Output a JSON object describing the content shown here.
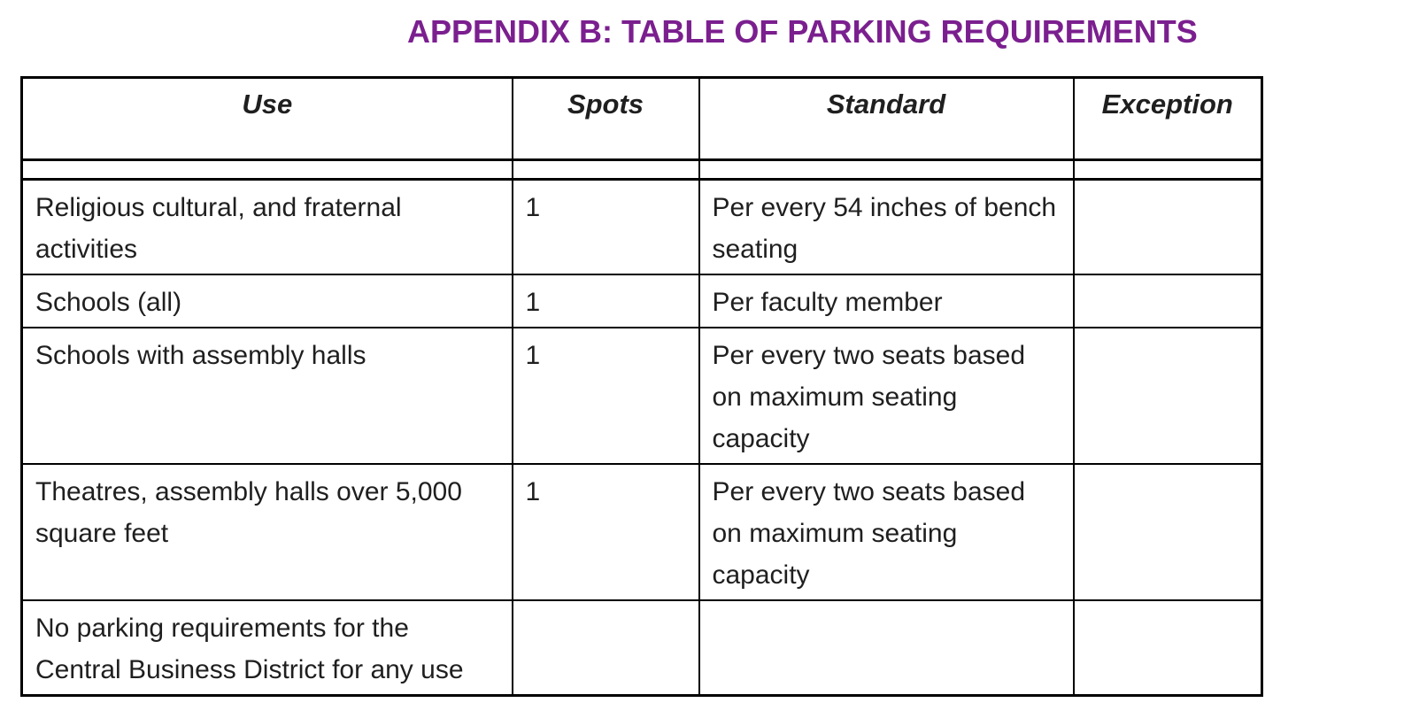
{
  "title": "APPENDIX B: TABLE OF PARKING REQUIREMENTS",
  "table": {
    "headers": {
      "use": "Use",
      "spots": "Spots",
      "standard": "Standard",
      "exception": "Exception"
    },
    "rows": [
      {
        "use": "Religious cultural, and fraternal activities",
        "spots": "1",
        "standard": "Per every 54 inches of bench seating",
        "exception": ""
      },
      {
        "use": "Schools (all)",
        "spots": "1",
        "standard": "Per faculty member",
        "exception": ""
      },
      {
        "use": "Schools with assembly halls",
        "spots": "1",
        "standard": "Per every two seats based on maximum seating capacity",
        "exception": ""
      },
      {
        "use": "Theatres, assembly halls over 5,000 square feet",
        "spots": "1",
        "standard": "Per every two seats based on maximum seating capacity",
        "exception": ""
      },
      {
        "use": "No parking requirements for the Central Business District for any use",
        "spots": "",
        "standard": "",
        "exception": ""
      }
    ]
  },
  "colors": {
    "title": "#7b1f8f",
    "text": "#1f1f1f",
    "border": "#000000"
  }
}
